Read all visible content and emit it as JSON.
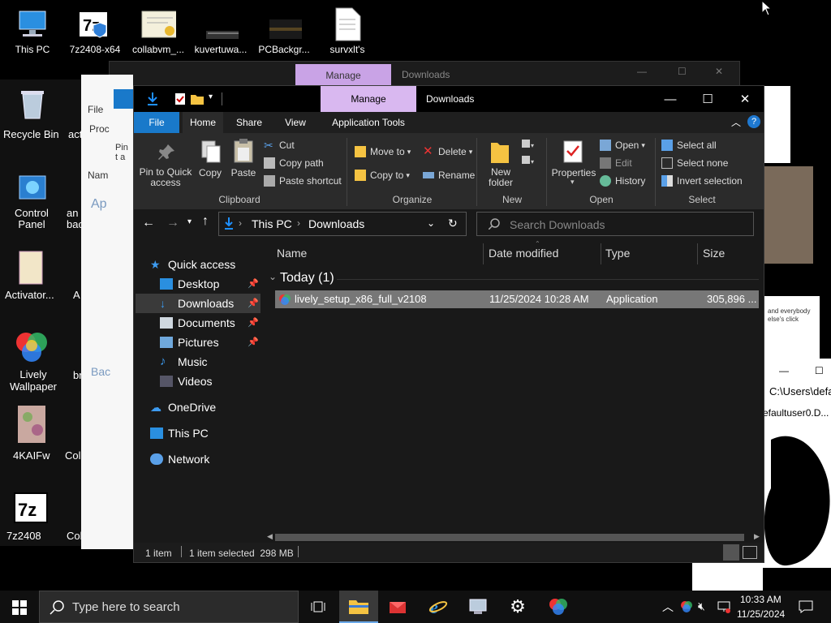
{
  "desktop": {
    "top_icons": [
      {
        "label": "This PC"
      },
      {
        "label": "7z2408-x64"
      },
      {
        "label": "collabvm_..."
      },
      {
        "label": "kuvertuwa..."
      },
      {
        "label": "PCBackgr..."
      },
      {
        "label": "survxlt's"
      }
    ],
    "left_icons": [
      {
        "label": "Recycle Bin"
      },
      {
        "label": "Control Panel"
      },
      {
        "label": "Activator..."
      },
      {
        "label": "Lively Wallpaper"
      },
      {
        "label": "4KAIFw"
      },
      {
        "label": "7z2408"
      }
    ],
    "partial_labels": [
      "act",
      "an bac",
      "A",
      "br",
      "Col",
      "Col"
    ]
  },
  "back_window": {
    "manage_label": "Manage",
    "title": "Downloads",
    "ribbon_labels": [
      "File",
      "Proc",
      "Pin t a",
      "Nam",
      "Ap",
      "Bac"
    ]
  },
  "right_window": {
    "path": "C:\\Users\\defa",
    "item": "efaultuser0.D..."
  },
  "note_text": "and everybody else's click",
  "explorer": {
    "manage_label": "Manage",
    "title": "Downloads",
    "tabs": [
      "File",
      "Home",
      "Share",
      "View",
      "Application Tools"
    ],
    "ribbon": {
      "clipboard": {
        "pin": "Pin to Quick access",
        "copy": "Copy",
        "paste": "Paste",
        "cut": "Cut",
        "copy_path": "Copy path",
        "paste_shortcut": "Paste shortcut",
        "label": "Clipboard"
      },
      "organize": {
        "move_to": "Move to",
        "copy_to": "Copy to",
        "delete": "Delete",
        "rename": "Rename",
        "label": "Organize"
      },
      "new": {
        "new_folder": "New folder",
        "label": "New"
      },
      "open": {
        "properties": "Properties",
        "open": "Open",
        "edit": "Edit",
        "history": "History",
        "label": "Open"
      },
      "select": {
        "select_all": "Select all",
        "select_none": "Select none",
        "invert": "Invert selection",
        "label": "Select"
      }
    },
    "address": {
      "this_pc": "This PC",
      "downloads": "Downloads"
    },
    "search_placeholder": "Search Downloads",
    "nav": [
      {
        "label": "Quick access",
        "pinned": false
      },
      {
        "label": "Desktop",
        "pinned": true
      },
      {
        "label": "Downloads",
        "pinned": true
      },
      {
        "label": "Documents",
        "pinned": true
      },
      {
        "label": "Pictures",
        "pinned": true
      },
      {
        "label": "Music",
        "pinned": false
      },
      {
        "label": "Videos",
        "pinned": false
      },
      {
        "label": "OneDrive",
        "pinned": false
      },
      {
        "label": "This PC",
        "pinned": false
      },
      {
        "label": "Network",
        "pinned": false
      }
    ],
    "columns": [
      "Name",
      "Date modified",
      "Type",
      "Size"
    ],
    "group": "Today (1)",
    "file": {
      "name": "lively_setup_x86_full_v2108",
      "date": "11/25/2024 10:28 AM",
      "type": "Application",
      "size": "305,896 ..."
    },
    "status": {
      "count": "1 item",
      "selected": "1 item selected  298 MB"
    }
  },
  "taskbar": {
    "search_placeholder": "Type here to search",
    "time": "10:33 AM",
    "date": "11/25/2024"
  },
  "colors": {
    "manage_tab": "#d9b8f0",
    "file_tab": "#1979ca",
    "accent": "#0078d7"
  }
}
